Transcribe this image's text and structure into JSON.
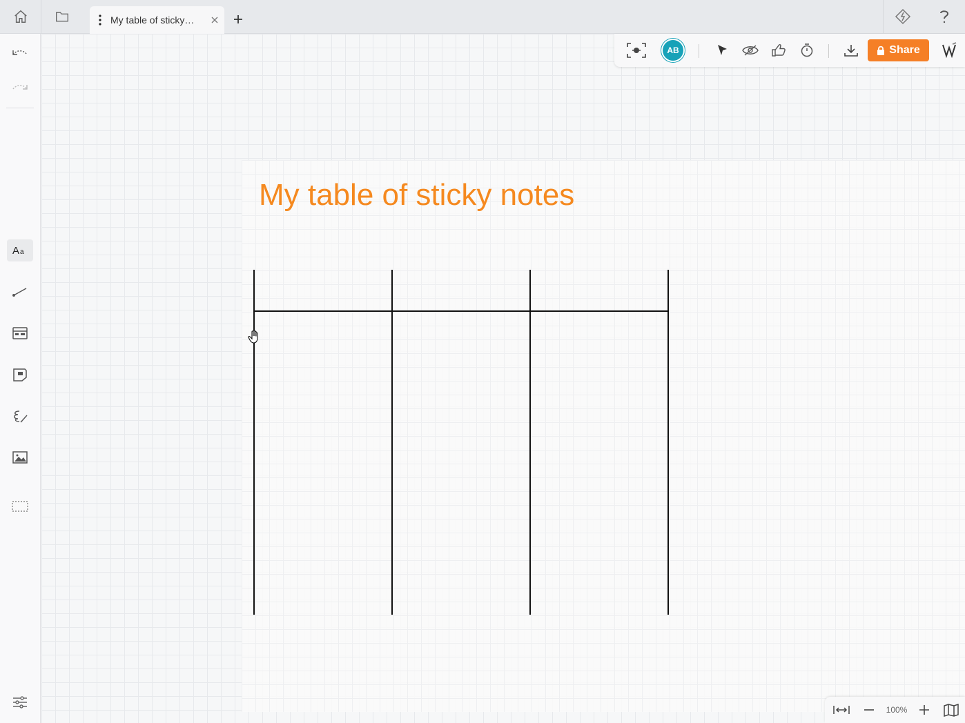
{
  "tabbar": {
    "active_tab_title": "My table of sticky…",
    "icons": {
      "home": "home-icon",
      "folder": "folder-icon",
      "menu": "kebab-menu-icon",
      "close": "close-icon",
      "new_tab": "plus-icon",
      "diamond": "diamond-icon",
      "help": "help-icon"
    }
  },
  "board": {
    "title": "My table of sticky notes",
    "title_color": "#f5891f"
  },
  "toolbar": {
    "avatar_initials": "AB",
    "share_label": "Share",
    "accent_color": "#f57f26"
  },
  "zoom": {
    "level": "100%"
  }
}
